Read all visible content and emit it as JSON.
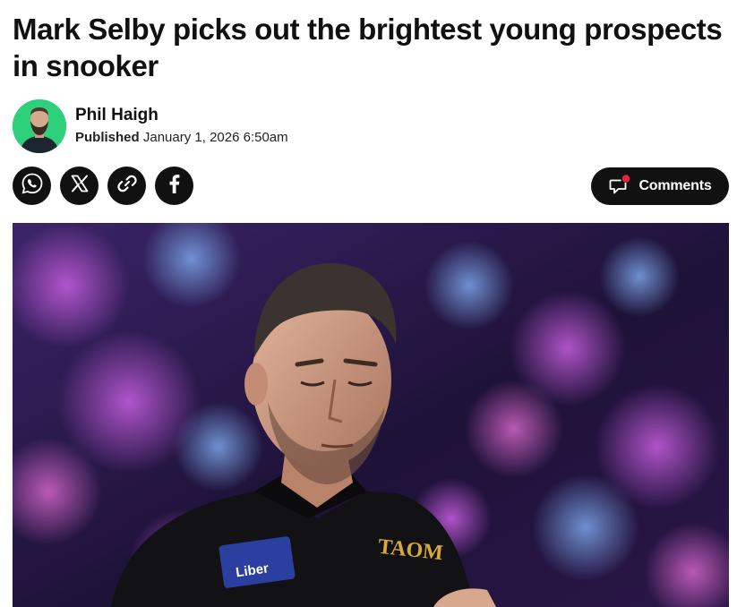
{
  "article": {
    "headline": "Mark Selby picks out the brightest young prospects in snooker"
  },
  "byline": {
    "author": "Phil Haigh",
    "published_label": "Published",
    "published_date": "January 1, 2026 6:50am",
    "avatar_bg": "#2fd07c"
  },
  "share": {
    "buttons": [
      {
        "icon": "whatsapp-icon"
      },
      {
        "icon": "x-icon"
      },
      {
        "icon": "link-icon"
      },
      {
        "icon": "facebook-icon"
      }
    ]
  },
  "comments": {
    "label": "Comments",
    "icon": "comment-bubble-icon",
    "notification_color": "#e8243c"
  },
  "hero_image": {
    "description_icon": "photo",
    "sponsor_patch_text": "Liber",
    "logo_patch_text": "TAOM"
  },
  "colors": {
    "text": "#111111",
    "button_bg": "#111111",
    "avatar_bg": "#2fd07c"
  }
}
